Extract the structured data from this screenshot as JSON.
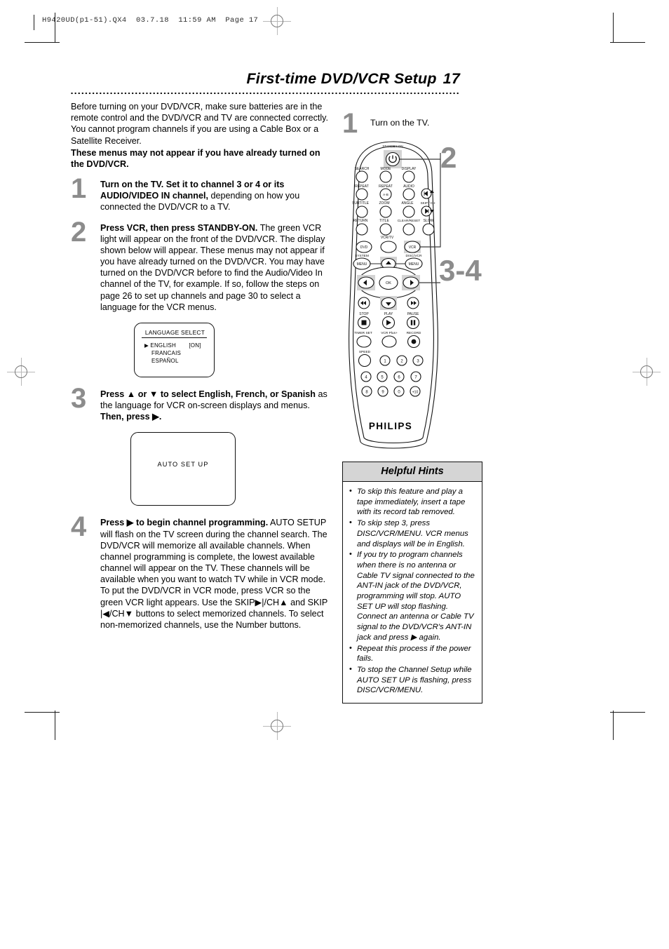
{
  "printer": {
    "slug": "H9420UD(p1-51).QX4  03.7.18  11:59 AM  Page 17"
  },
  "header": {
    "title": "First-time DVD/VCR Setup",
    "page_number": "17"
  },
  "intro": {
    "paragraph": "Before turning on your DVD/VCR, make sure batteries are in the remote control and the DVD/VCR and TV are connected correctly. You cannot program channels if you are using a Cable Box or a Satellite Receiver.",
    "bold_note": "These menus may not appear if you have already turned on the DVD/VCR."
  },
  "steps": [
    {
      "number": "1",
      "bold": "Turn on the TV. Set it to channel 3 or 4 or its AUDIO/VIDEO IN channel,",
      "rest": " depending on how you connected the DVD/VCR to a TV."
    },
    {
      "number": "2",
      "bold": "Press VCR, then press STANDBY-ON.",
      "rest": " The green VCR light will appear on the front of the DVD/VCR. The display shown below will appear.",
      "rest2": "These menus may not appear if you have already turned on the DVD/VCR. You may have turned on the DVD/VCR before to find the Audio/Video In channel of the TV, for example. If so, follow the steps on page 26 to set up channels and page 30 to select a language for the VCR menus."
    },
    {
      "number": "3",
      "bold": "Press ▲ or ▼ to select English, French, or Spanish",
      "rest": " as the language for VCR on-screen displays and menus. ",
      "bold2": "Then, press ▶."
    },
    {
      "number": "4",
      "bold": "Press ▶ to begin channel programming.",
      "rest": " AUTO SETUP will flash on the TV screen during the channel search. The DVD/VCR will memorize all available channels. When channel programming is complete, the lowest available channel will appear on the TV.",
      "rest2": "These channels will be available when you want to watch TV while in VCR mode. To put the DVD/VCR in VCR mode, press VCR so the green VCR light appears. Use the SKIP▶|/CH▲ and SKIP |◀/CH▼ buttons to select memorized channels. To select non-memorized channels, use the Number buttons."
    }
  ],
  "language_screen": {
    "title": "LANGUAGE SELECT",
    "options": [
      "ENGLISH",
      "FRANCAIS",
      "ESPAÑOL"
    ],
    "selected_marker": "▶",
    "selected_status": "[ON]"
  },
  "auto_screen": {
    "text": "AUTO SET UP"
  },
  "remote": {
    "step1_number": "1",
    "step1_text": "Turn on the TV.",
    "callout_2": "2",
    "callout_34": "3-4",
    "brand": "PHILIPS",
    "standby_label": "STANDBY-ON",
    "labels_row1": [
      "SEARCH",
      "MODE",
      "DISPLAY"
    ],
    "labels_row2": [
      "REPEAT",
      "REPEAT",
      "AUDIO"
    ],
    "labels_row3": [
      "SUBTITLE",
      "ZOOM",
      "ANGLE",
      "SKIP / CH"
    ],
    "labels_row4": [
      "RETURN",
      "TITLE",
      "CLEAR/RESET",
      "SLOW"
    ],
    "zoom_btn": "A-B",
    "vcrtv_label": "VCR/TV",
    "dvd_btn": "DVD",
    "vcr_btn": "VCR",
    "system_label": "SYSTEM",
    "discvcr_label": "DISC/VCR",
    "menu_btn_left": "MENU",
    "menu_btn_right": "MENU",
    "ok_btn": "OK",
    "transport_labels": [
      "STOP",
      "PLAY",
      "PAUSE"
    ],
    "record_labels": [
      "TIMER SET",
      "VCR Plus+",
      "RECORD"
    ],
    "speed_label": "SPEED",
    "numbers": [
      "1",
      "2",
      "3",
      "4",
      "5",
      "6",
      "7",
      "8",
      "9",
      "0",
      "+10"
    ]
  },
  "hints": {
    "title": "Helpful Hints",
    "items": [
      "To skip this feature and play a tape immediately, insert a tape with its record tab removed.",
      "To skip step 3, press DISC/VCR/MENU. VCR menus and displays will be in English.",
      "If you try to program channels when there is no antenna or Cable TV signal connected to the ANT-IN jack of the DVD/VCR, programming will stop. AUTO SET UP will stop flashing. Connect an antenna or Cable TV signal to the DVD/VCR's ANT-IN jack and press ▶ again.",
      "Repeat this process if the power fails.",
      "To stop the Channel Setup while AUTO SET UP is flashing, press DISC/VCR/MENU."
    ]
  }
}
